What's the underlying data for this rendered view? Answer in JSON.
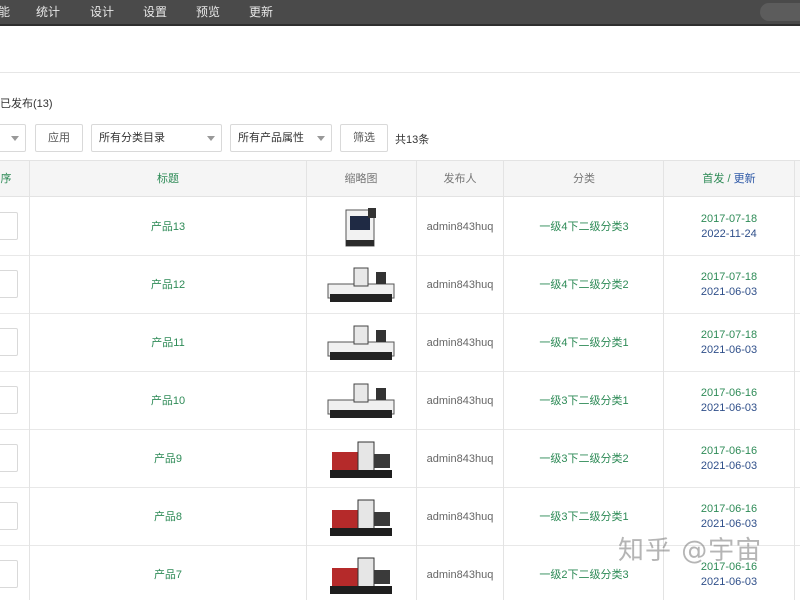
{
  "nav": {
    "items": [
      "能",
      "统计",
      "设计",
      "设置",
      "预览",
      "更新"
    ]
  },
  "section": {
    "title": "已发布(13)"
  },
  "filters": {
    "apply_label": "应用",
    "category_select": "所有分类目录",
    "attribute_select": "所有产品属性",
    "filter_label": "筛选",
    "count_text": "共13条"
  },
  "table": {
    "headers": {
      "order": "序",
      "title": "标题",
      "thumbnail": "缩略图",
      "author": "发布人",
      "category": "分类",
      "date_first": "首发",
      "date_sep": " / ",
      "date_update": "更新"
    },
    "rows": [
      {
        "title": "产品13",
        "author": "admin843huq",
        "category": "一级4下二级分类3",
        "first": "2017-07-18",
        "update": "2022-11-24",
        "thumb": "vertical-machining-center"
      },
      {
        "title": "产品12",
        "author": "admin843huq",
        "category": "一级4下二级分类2",
        "first": "2017-07-18",
        "update": "2021-06-03",
        "thumb": "gantry-machine"
      },
      {
        "title": "产品11",
        "author": "admin843huq",
        "category": "一级4下二级分类1",
        "first": "2017-07-18",
        "update": "2021-06-03",
        "thumb": "gantry-machine"
      },
      {
        "title": "产品10",
        "author": "admin843huq",
        "category": "一级3下二级分类1",
        "first": "2017-06-16",
        "update": "2021-06-03",
        "thumb": "gantry-machine"
      },
      {
        "title": "产品9",
        "author": "admin843huq",
        "category": "一级3下二级分类2",
        "first": "2017-06-16",
        "update": "2021-06-03",
        "thumb": "boring-machine"
      },
      {
        "title": "产品8",
        "author": "admin843huq",
        "category": "一级3下二级分类1",
        "first": "2017-06-16",
        "update": "2021-06-03",
        "thumb": "boring-machine"
      },
      {
        "title": "产品7",
        "author": "admin843huq",
        "category": "一级2下二级分类3",
        "first": "2017-06-16",
        "update": "2021-06-03",
        "thumb": "boring-machine"
      }
    ]
  },
  "watermark": "知乎 @宇宙"
}
